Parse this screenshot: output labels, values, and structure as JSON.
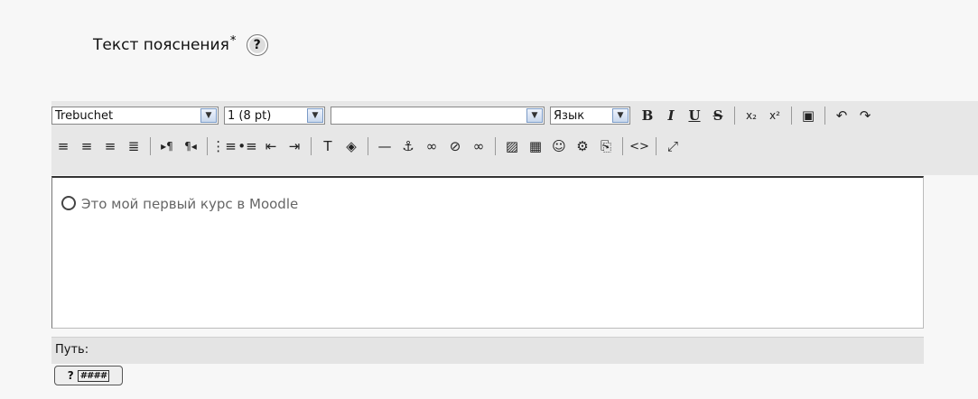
{
  "field": {
    "label": "Текст пояснения",
    "required_mark": "*",
    "help_symbol": "?"
  },
  "toolbar": {
    "font_family": "Trebuchet",
    "font_size": "1 (8 pt)",
    "style_value": "",
    "language": "Язык",
    "row1_icons": [
      {
        "name": "bold-icon",
        "glyph": "B"
      },
      {
        "name": "italic-icon",
        "glyph": "I"
      },
      {
        "name": "underline-icon",
        "glyph": "U"
      },
      {
        "name": "strikethrough-icon",
        "glyph": "S"
      },
      {
        "name": "subscript-icon",
        "glyph": "x₂"
      },
      {
        "name": "superscript-icon",
        "glyph": "x²"
      },
      {
        "name": "paste-word-icon",
        "glyph": "▣"
      },
      {
        "name": "undo-icon",
        "glyph": "↶"
      },
      {
        "name": "redo-icon",
        "glyph": "↷"
      }
    ],
    "row2_icons": [
      {
        "name": "align-left-icon",
        "glyph": "≡"
      },
      {
        "name": "align-center-icon",
        "glyph": "≡"
      },
      {
        "name": "align-right-icon",
        "glyph": "≡"
      },
      {
        "name": "justify-icon",
        "glyph": "≣"
      },
      {
        "name": "ltr-icon",
        "glyph": "▸¶"
      },
      {
        "name": "rtl-icon",
        "glyph": "¶◂"
      },
      {
        "name": "ordered-list-icon",
        "glyph": "⋮≡"
      },
      {
        "name": "unordered-list-icon",
        "glyph": "•≡"
      },
      {
        "name": "outdent-icon",
        "glyph": "⇤"
      },
      {
        "name": "indent-icon",
        "glyph": "⇥"
      },
      {
        "name": "text-color-icon",
        "glyph": "T"
      },
      {
        "name": "background-color-icon",
        "glyph": "◈"
      },
      {
        "name": "horizontal-rule-icon",
        "glyph": "—"
      },
      {
        "name": "anchor-icon",
        "glyph": "⚓"
      },
      {
        "name": "link-icon",
        "glyph": "∞"
      },
      {
        "name": "unlink-icon",
        "glyph": "⊘"
      },
      {
        "name": "nolink-icon",
        "glyph": "∞"
      },
      {
        "name": "insert-image-icon",
        "glyph": "▨"
      },
      {
        "name": "insert-table-icon",
        "glyph": "▦"
      },
      {
        "name": "insert-smiley-icon",
        "glyph": "☺"
      },
      {
        "name": "insert-special-char-icon",
        "glyph": "⚙"
      },
      {
        "name": "search-replace-icon",
        "glyph": "⎘"
      },
      {
        "name": "html-source-icon",
        "glyph": "<>"
      },
      {
        "name": "fullscreen-icon",
        "glyph": "⤢"
      }
    ]
  },
  "editor": {
    "content_text": "Это мой первый курс в Moodle",
    "smiley_glyph": "☺"
  },
  "pathbar": {
    "label": "Путь:"
  },
  "keyboard_help": {
    "symbol": "?",
    "keyboard_glyph": "####"
  }
}
